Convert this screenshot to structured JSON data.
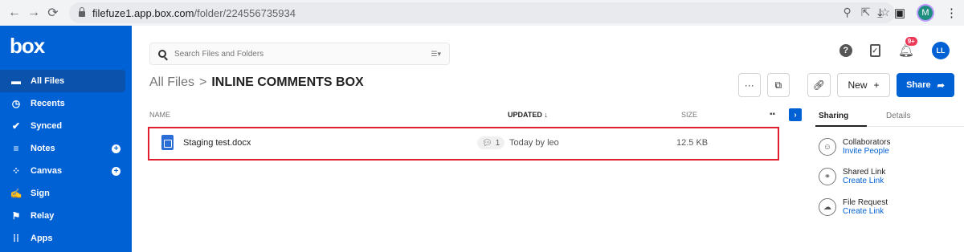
{
  "browser": {
    "back": "←",
    "forward": "→",
    "reload": "C",
    "url_host": "filefuze1.app.box.com",
    "url_path": "/folder/224556735934",
    "profile_letter": "M"
  },
  "sidebar": {
    "logo": "box",
    "items": [
      {
        "label": "All Files",
        "icon": "folder-icon"
      },
      {
        "label": "Recents",
        "icon": "clock-icon"
      },
      {
        "label": "Synced",
        "icon": "check-circle-icon"
      },
      {
        "label": "Notes",
        "icon": "notes-icon"
      },
      {
        "label": "Canvas",
        "icon": "canvas-icon"
      },
      {
        "label": "Sign",
        "icon": "sign-icon"
      },
      {
        "label": "Relay",
        "icon": "relay-icon"
      },
      {
        "label": "Apps",
        "icon": "apps-icon"
      }
    ]
  },
  "header": {
    "search_placeholder": "Search Files and Folders",
    "notifications_count": "9+",
    "avatar_initials": "LL"
  },
  "breadcrumb": {
    "root": "All Files",
    "separator": ">",
    "current": "INLINE COMMENTS BOX"
  },
  "actions": {
    "more": "···",
    "new_label": "New",
    "share_label": "Share"
  },
  "table": {
    "headers": {
      "name": "NAME",
      "updated": "UPDATED ↓",
      "size": "SIZE"
    },
    "rows": [
      {
        "name": "Staging test.docx",
        "comments": "1",
        "updated": "Today by leo",
        "size": "12.5 KB"
      }
    ]
  },
  "right_panel": {
    "tabs": [
      "Sharing",
      "Details"
    ],
    "items": [
      {
        "title": "Collaborators",
        "link": "Invite People"
      },
      {
        "title": "Shared Link",
        "link": "Create Link"
      },
      {
        "title": "File Request",
        "link": "Create Link"
      }
    ]
  },
  "colors": {
    "brand": "#0061d5",
    "highlight": "#e01e2d"
  }
}
